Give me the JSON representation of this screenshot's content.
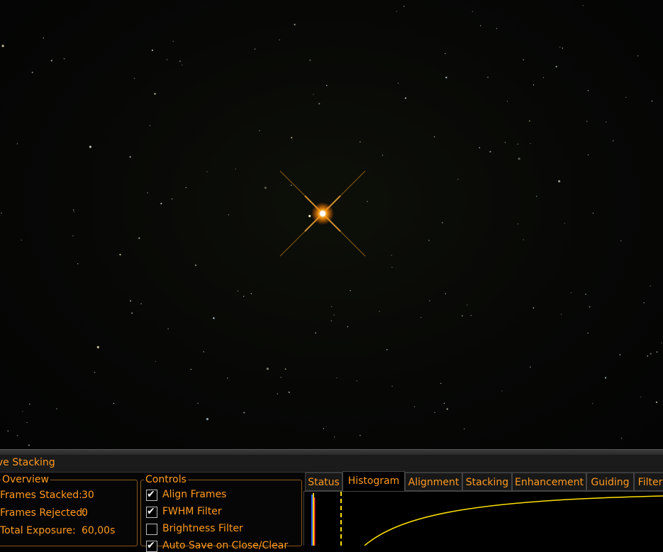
{
  "panel_title": "ive Stacking",
  "overview": {
    "title": "Overview",
    "rows": [
      {
        "label": "Frames Stacked:",
        "value": "30"
      },
      {
        "label": "Frames Rejected:",
        "value": "0"
      },
      {
        "label": "Total Exposure:",
        "value": "60,00s"
      }
    ]
  },
  "controls": {
    "title": "Controls",
    "items": [
      {
        "label": "Align Frames",
        "checked": true
      },
      {
        "label": "FWHM Filter",
        "checked": true
      },
      {
        "label": "Brightness Filter",
        "checked": false
      },
      {
        "label": "Auto Save on Close/Clear",
        "checked": true
      }
    ]
  },
  "tabs": [
    "Status",
    "Histogram",
    "Alignment",
    "Stacking",
    "Enhancement",
    "Guiding",
    "Filter"
  ],
  "active_tab": "Histogram",
  "colors": {
    "accent": "#ff9a1f",
    "background": "#060606",
    "star": "#ffb030"
  }
}
